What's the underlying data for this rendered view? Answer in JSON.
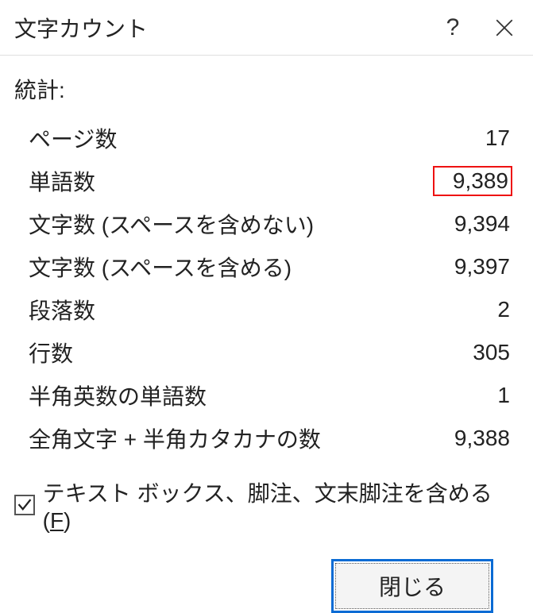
{
  "titlebar": {
    "title": "文字カウント",
    "help": "?"
  },
  "section_label": "統計:",
  "stats": [
    {
      "label": "ページ数",
      "value": "17",
      "highlight": false
    },
    {
      "label": "単語数",
      "value": "9,389",
      "highlight": true
    },
    {
      "label": "文字数 (スペースを含めない)",
      "value": "9,394",
      "highlight": false
    },
    {
      "label": "文字数 (スペースを含める)",
      "value": "9,397",
      "highlight": false
    },
    {
      "label": "段落数",
      "value": "2",
      "highlight": false
    },
    {
      "label": "行数",
      "value": "305",
      "highlight": false
    },
    {
      "label": "半角英数の単語数",
      "value": "1",
      "highlight": false
    },
    {
      "label": "全角文字 + 半角カタカナの数",
      "value": "9,388",
      "highlight": false
    }
  ],
  "checkbox": {
    "checked": true,
    "label_pre": "テキスト ボックス、脚注、文末脚注を含める(",
    "accelerator": "F",
    "label_post": ")"
  },
  "close_button": "閉じる"
}
